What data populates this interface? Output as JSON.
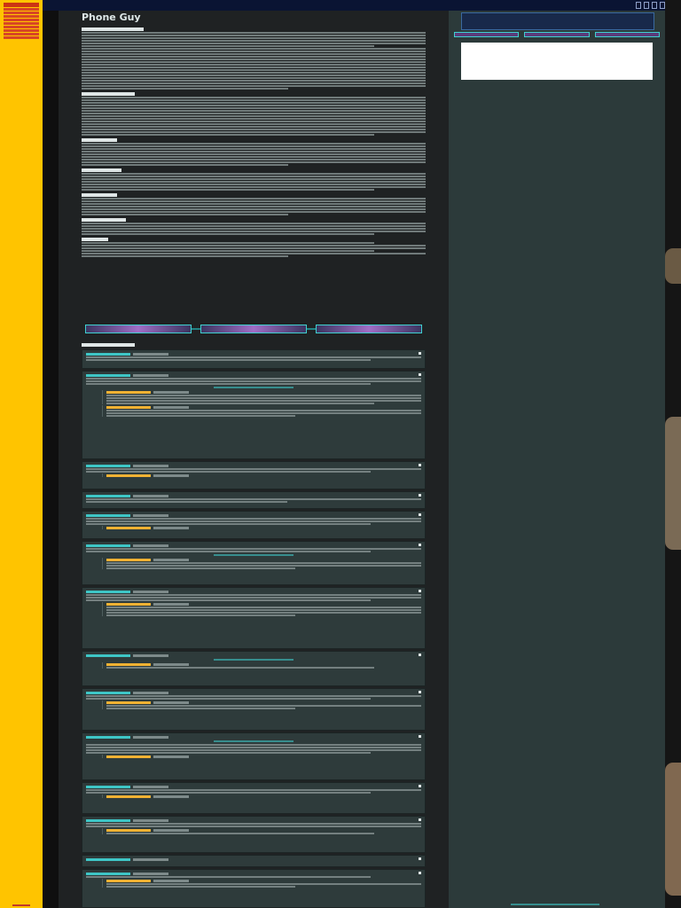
{
  "page": {
    "title": "Phone Guy",
    "accent": "#25c6c6",
    "leftbar_color": "#ffc400"
  },
  "topbar": {
    "text": "",
    "buttons": [
      "",
      "",
      "",
      ""
    ]
  },
  "icons": {
    "more": "more-icon"
  }
}
